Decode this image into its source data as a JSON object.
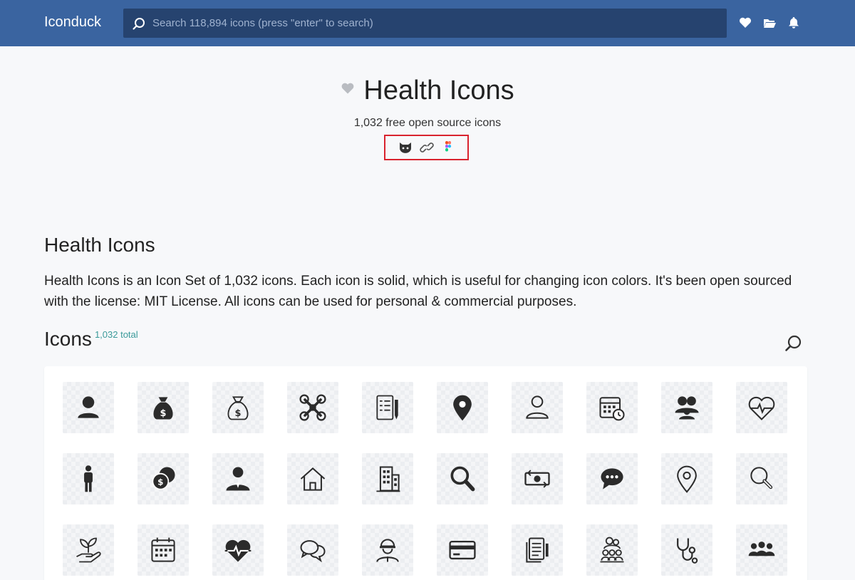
{
  "header": {
    "logo": "Iconduck",
    "search_placeholder": "Search 118,894 icons (press \"enter\" to search)",
    "icons": [
      "heart-icon",
      "folder-icon",
      "bell-icon"
    ]
  },
  "hero": {
    "title": "Health Icons",
    "subtitle": "1,032 free open source icons",
    "links": [
      "github-icon",
      "link-icon",
      "figma-icon"
    ]
  },
  "about": {
    "title": "Health Icons",
    "description": "Health Icons is an Icon Set of 1,032 icons. Each icon is solid, which is useful for changing icon colors. It's been open sourced with the license: MIT License. All icons can be used for personal & commercial purposes."
  },
  "icons_section": {
    "title": "Icons",
    "count": "1,032 total"
  },
  "grid": {
    "rows": [
      [
        "person-icon",
        "money-bag-icon",
        "money-bag-outline-icon",
        "drone-icon",
        "clipboard-list-icon",
        "location-pin-icon",
        "person-outline-icon",
        "calendar-clock-icon",
        "group-icon",
        "heart-pulse-outline-icon"
      ],
      [
        "standing-person-icon",
        "coins-icon",
        "doctor-icon",
        "home-outline-icon",
        "hospital-building-icon",
        "magnifier-icon",
        "money-transfer-icon",
        "chat-bubble-icon",
        "location-pin-outline-icon",
        "magnifier-outline-icon"
      ],
      [
        "plant-hand-icon",
        "calendar-icon",
        "heart-pulse-icon",
        "conversation-icon",
        "worker-icon",
        "credit-card-icon",
        "documents-icon",
        "community-icon",
        "stethoscope-icon",
        "people-icon"
      ]
    ]
  },
  "colors": {
    "header_bg": "#3a64a0",
    "search_bg": "#26436f",
    "highlight": "#d9232e",
    "count_accent": "#3a9a9a",
    "icon_fill": "#2b2b2b"
  }
}
